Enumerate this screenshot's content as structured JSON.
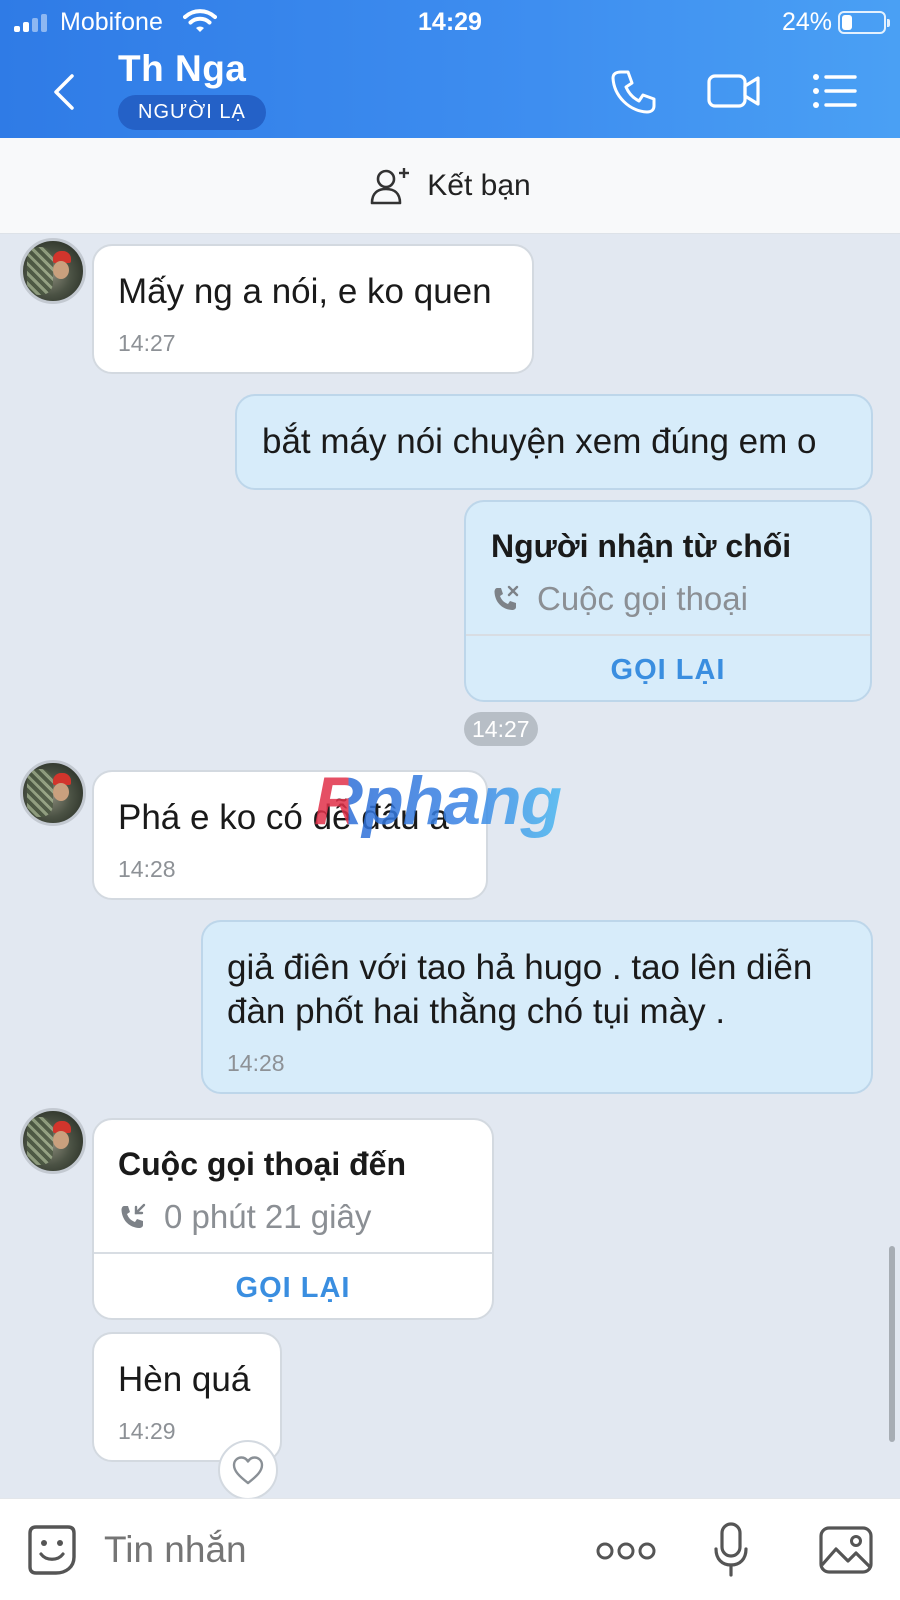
{
  "status_bar": {
    "carrier": "Mobifone",
    "time": "14:29",
    "battery_percent": "24%",
    "battery_level": 0.24
  },
  "header": {
    "contact_name": "Th Nga",
    "badge": "NGƯỜI LẠ",
    "icons": [
      "back-icon",
      "phone-icon",
      "video-icon",
      "menu-icon"
    ]
  },
  "friend_bar": {
    "label": "Kết bạn",
    "icon": "add-friend-icon"
  },
  "messages": [
    {
      "dir": "in",
      "text": "Mấy ng a nói, e ko quen",
      "time": "14:27"
    },
    {
      "dir": "out",
      "text": "bắt máy nói chuyện xem đúng em o"
    },
    {
      "dir": "out",
      "type": "call",
      "title": "Người nhận từ chối",
      "subtitle": "Cuộc gọi thoại",
      "action": "GỌI LẠI",
      "icon": "missed-call-icon"
    },
    {
      "dir": "in",
      "text": "Phá e ko có dễ đâu a",
      "time": "14:28"
    },
    {
      "dir": "out",
      "text_line1": "giả điên với tao hả hugo . tao lên diễn",
      "text_line2": "đàn phốt hai thằng chó tụi mày .",
      "time": "14:28"
    },
    {
      "dir": "in",
      "type": "call",
      "title": "Cuộc gọi thoại đến",
      "subtitle": "0 phút 21 giây",
      "action": "GỌI LẠI",
      "icon": "incoming-call-icon"
    },
    {
      "dir": "in",
      "text": "Hèn quá",
      "time": "14:29"
    }
  ],
  "time_pill": "14:27",
  "watermark": "Rphang",
  "input_bar": {
    "placeholder": "Tin nhắn",
    "icons": [
      "sticker-icon",
      "more-icon",
      "microphone-icon",
      "image-icon"
    ]
  },
  "colors": {
    "header": "#3e8ef0",
    "badge": "#2461c7",
    "outgoing_bubble": "#d7ecfa",
    "incoming_bubble": "#ffffff",
    "chat_background": "#e2e8f1",
    "callback_text": "#3a8ee0"
  }
}
